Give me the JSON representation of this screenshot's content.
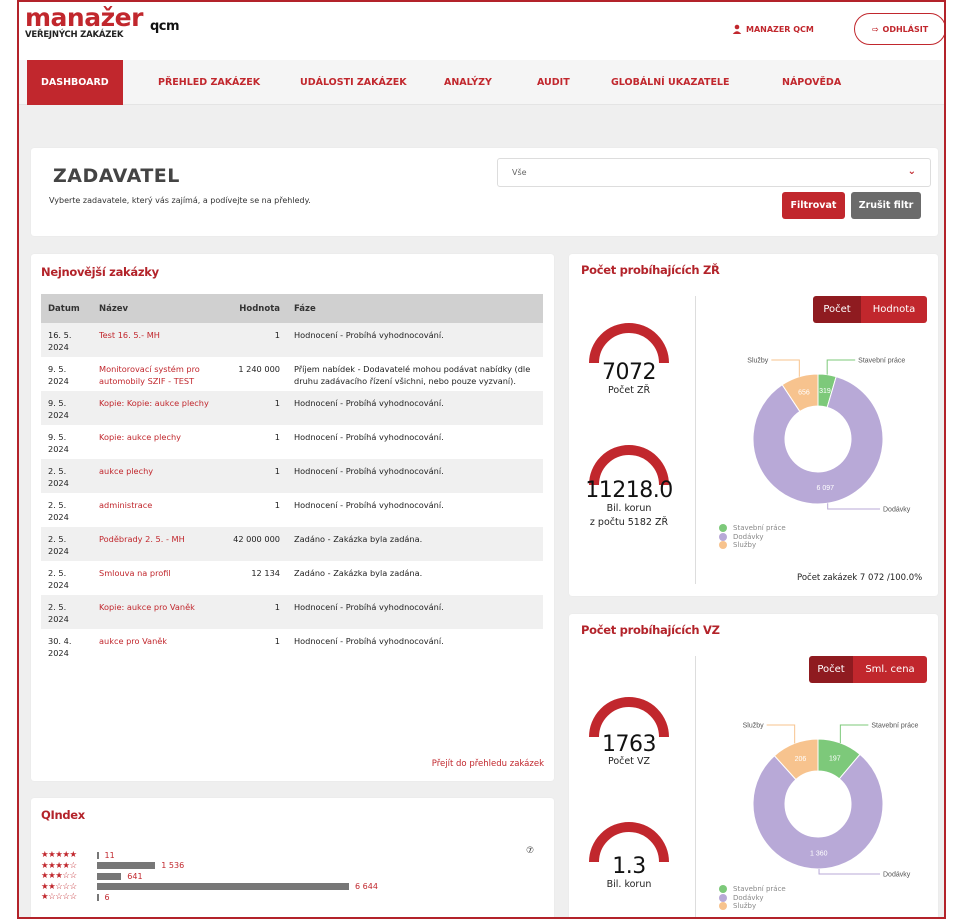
{
  "header": {
    "logo_main": "manažer",
    "logo_sub": "VEŘEJNÝCH ZAKÁZEK",
    "brand": "qcm",
    "user": "MANAZER QCM",
    "logout": "ODHLÁSIT"
  },
  "nav": {
    "items": [
      "DASHBOARD",
      "PŘEHLED ZAKÁZEK",
      "UDÁLOSTI ZAKÁZEK",
      "ANALÝZY",
      "AUDIT",
      "GLOBÁLNÍ UKAZATELE",
      "NÁPOVĚDA"
    ],
    "active": "DASHBOARD"
  },
  "zadavatel": {
    "title": "ZADAVATEL",
    "description": "Vyberte zadavatele, který vás zajímá, a podívejte se na přehledy.",
    "select_value": "Vše",
    "filter_button": "Filtrovat",
    "clear_button": "Zrušit filtr"
  },
  "latest": {
    "title": "Nejnovější zakázky",
    "columns": [
      "Datum",
      "Název",
      "Hodnota",
      "Fáze"
    ],
    "rows": [
      {
        "date": "16. 5. 2024",
        "name": "Test 16. 5.- MH",
        "value": "1",
        "phase": "Hodnocení - Probíhá vyhodnocování."
      },
      {
        "date": "9. 5. 2024",
        "name": "Monitorovací systém pro automobily SZIF - TEST",
        "value": "1 240 000",
        "phase": "Příjem nabídek - Dodavatelé mohou podávat nabídky (dle druhu zadávacího řízení všichni, nebo pouze vyzvaní)."
      },
      {
        "date": "9. 5. 2024",
        "name": "Kopie: Kopie: aukce plechy",
        "value": "1",
        "phase": "Hodnocení - Probíhá vyhodnocování."
      },
      {
        "date": "9. 5. 2024",
        "name": "Kopie: aukce plechy",
        "value": "1",
        "phase": "Hodnocení - Probíhá vyhodnocování."
      },
      {
        "date": "2. 5. 2024",
        "name": "aukce plechy",
        "value": "1",
        "phase": "Hodnocení - Probíhá vyhodnocování."
      },
      {
        "date": "2. 5. 2024",
        "name": "administrace",
        "value": "1",
        "phase": "Hodnocení - Probíhá vyhodnocování."
      },
      {
        "date": "2. 5. 2024",
        "name": "Poděbrady 2. 5. - MH",
        "value": "42 000 000",
        "phase": "Zadáno - Zakázka byla zadána."
      },
      {
        "date": "2. 5. 2024",
        "name": "Smlouva na profil",
        "value": "12 134",
        "phase": "Zadáno - Zakázka byla zadána."
      },
      {
        "date": "2. 5. 2024",
        "name": "Kopie: aukce pro Vaněk",
        "value": "1",
        "phase": "Hodnocení - Probíhá vyhodnocování."
      },
      {
        "date": "30. 4. 2024",
        "name": "aukce pro Vaněk",
        "value": "1",
        "phase": "Hodnocení - Probíhá vyhodnocování."
      }
    ],
    "more_link": "Přejít do přehledu zakázek"
  },
  "qindex": {
    "title": "QIndex",
    "rows": [
      {
        "stars": "★★★★★",
        "count": "11",
        "value": 11
      },
      {
        "stars": "★★★★☆",
        "count": "1 536",
        "value": 1536
      },
      {
        "stars": "★★★☆☆",
        "count": "641",
        "value": 641
      },
      {
        "stars": "★★☆☆☆",
        "count": "6 644",
        "value": 6644
      },
      {
        "stars": "★☆☆☆☆",
        "count": "6",
        "value": 6
      }
    ],
    "help": "⑦"
  },
  "zr": {
    "title": "Počet probíhajících ZŘ",
    "gauge1_value": "7072",
    "gauge1_label": "Počet ZŘ",
    "gauge2_value": "11218.0",
    "gauge2_label": "Bil. korun",
    "gauge2_sublabel": "z počtu 5182 ZŘ",
    "toggle": [
      "Počet",
      "Hodnota"
    ],
    "total": "Počet zakázek 7 072 /100.0%"
  },
  "vz": {
    "title": "Počet probíhajících VZ",
    "gauge1_value": "1763",
    "gauge1_label": "Počet VZ",
    "gauge2_value": "1.3",
    "gauge2_label": "Bil. korun",
    "toggle": [
      "Počet",
      "Sml. cena"
    ]
  },
  "legend": [
    "Stavební práce",
    "Dodávky",
    "Služby"
  ],
  "colors": {
    "accent": "#c1272d",
    "stavebni": "#7dc97a",
    "dodavky": "#b8a9d7",
    "sluzby": "#f7c38e"
  },
  "chart_data": [
    {
      "type": "pie",
      "title": "Počet probíhajících ZŘ",
      "categories": [
        "Stavební práce",
        "Dodávky",
        "Služby"
      ],
      "values": [
        319,
        6097,
        656
      ]
    },
    {
      "type": "pie",
      "title": "Počet probíhajících VZ",
      "categories": [
        "Stavební práce",
        "Dodávky",
        "Služby"
      ],
      "values": [
        197,
        1360,
        206
      ]
    }
  ]
}
